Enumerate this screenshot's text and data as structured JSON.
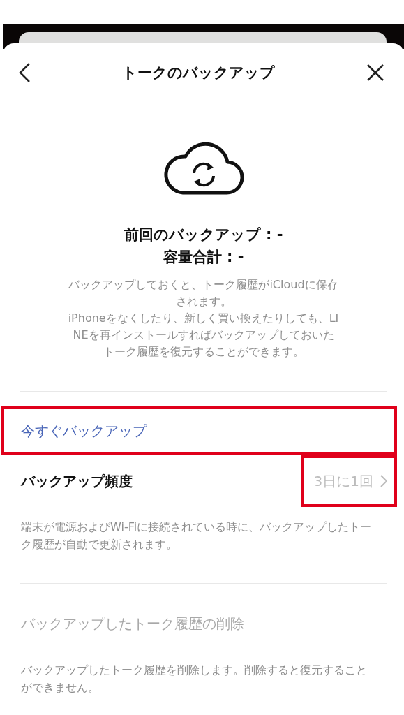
{
  "header": {
    "title": "トークのバックアップ"
  },
  "status": {
    "lines": [
      "前回のバックアップ : -",
      "容量合計 : -"
    ]
  },
  "description": [
    "バックアップしておくと、トーク履歴がiCloudに保存されます。",
    "iPhoneをなくしたり、新しく買い換えたりしても、LINEを再インストールすればバックアップしておいたトーク履歴を復元することができます。"
  ],
  "backup_now": {
    "label": "今すぐバックアップ",
    "highlighted": true
  },
  "frequency": {
    "label": "バックアップ頻度",
    "value": "3日に1回",
    "highlighted": true,
    "note": "端末が電源およびWi-Fiに接続されている時に、バックアップしたトーク履歴が自動で更新されます。"
  },
  "delete": {
    "label": "バックアップしたトーク履歴の削除",
    "disabled": true,
    "note": "バックアップしたトーク履歴を削除します。削除すると復元することができません。"
  }
}
